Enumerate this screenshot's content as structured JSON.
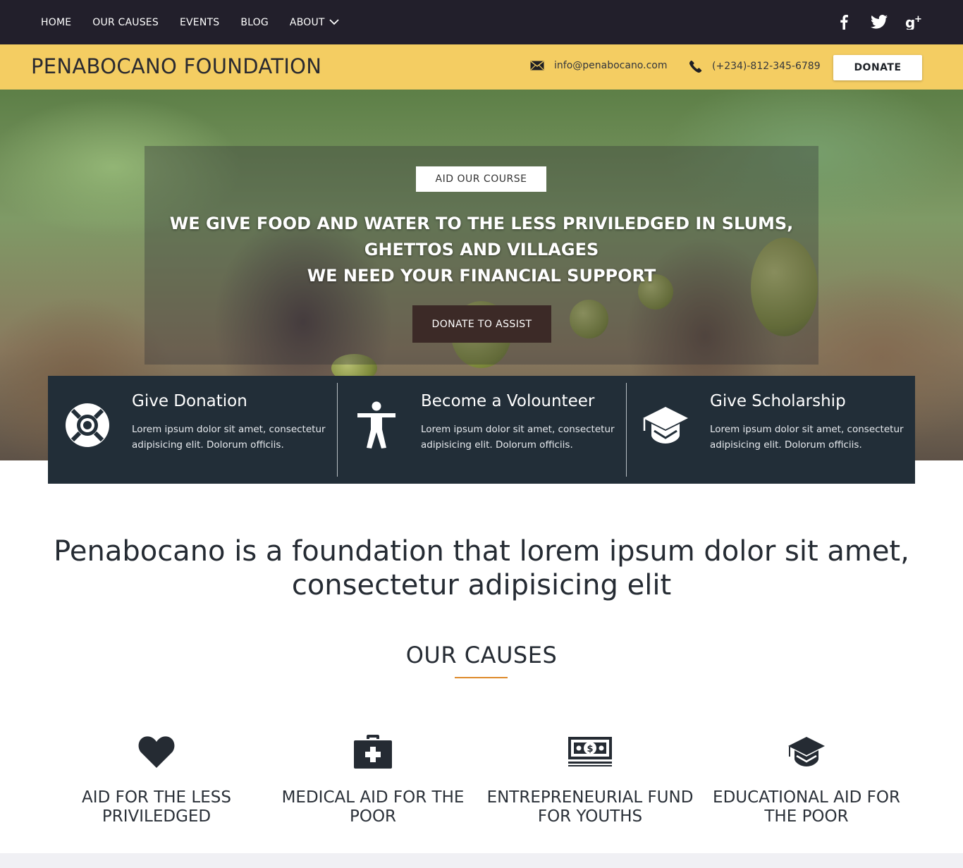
{
  "nav": {
    "items": [
      {
        "label": "HOME"
      },
      {
        "label": "OUR CAUSES"
      },
      {
        "label": "EVENTS"
      },
      {
        "label": "BLOG"
      },
      {
        "label": "ABOUT",
        "icon": "chevron-down-icon"
      }
    ],
    "social": [
      {
        "icon": "facebook-icon"
      },
      {
        "icon": "twitter-icon"
      },
      {
        "icon": "google-plus-icon"
      }
    ]
  },
  "brand": {
    "name": "PENABOCANO FOUNDATION",
    "email": "info@penabocano.com",
    "phone": "(+234)-812-345-6789",
    "donate_label": "DONATE",
    "accent_color": "#f4cd62"
  },
  "hero": {
    "tag_button": "AID OUR COURSE",
    "headline_line1": "WE GIVE FOOD AND WATER TO THE LESS PRIVILEDGED IN SLUMS,",
    "headline_line2": "GHETTOS AND VILLAGES",
    "headline_line3": "WE NEED YOUR FINANCIAL SUPPORT",
    "cta_button": "DONATE TO ASSIST"
  },
  "features": [
    {
      "icon": "lifebuoy-icon",
      "title": "Give Donation",
      "text": "Lorem ipsum dolor sit amet, consectetur adipisicing elit. Dolorum officiis."
    },
    {
      "icon": "person-icon",
      "title": "Become a Volounteer",
      "text": "Lorem ipsum dolor sit amet, consectetur adipisicing elit. Dolorum officiis."
    },
    {
      "icon": "graduation-cap-icon",
      "title": "Give Scholarship",
      "text": "Lorem ipsum dolor sit amet, consectetur adipisicing elit. Dolorum officiis."
    }
  ],
  "intro": {
    "text": "Penabocano is a foundation that lorem ipsum dolor sit amet, consectetur adipisicing elit"
  },
  "causes": {
    "title": "OUR CAUSES",
    "items": [
      {
        "icon": "heart-icon",
        "label": "AID FOR THE LESS PRIVILEDGED"
      },
      {
        "icon": "medical-kit-icon",
        "label": "MEDICAL AID FOR THE POOR"
      },
      {
        "icon": "money-icon",
        "label": "ENTREPRENEURIAL FUND FOR YOUTHS"
      },
      {
        "icon": "graduation-cap-icon",
        "label": "EDUCATIONAL AID FOR THE POOR"
      }
    ]
  }
}
